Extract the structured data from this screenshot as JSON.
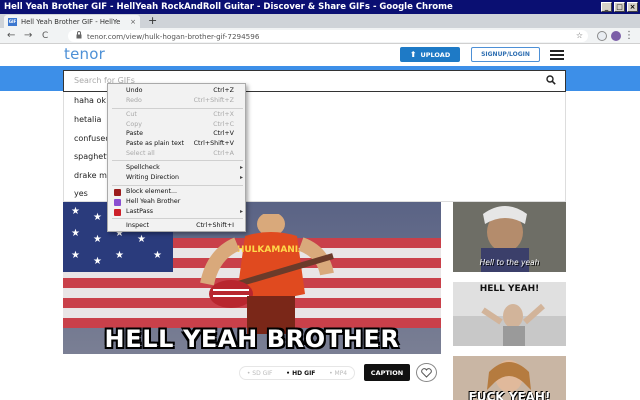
{
  "window": {
    "title": "Hell Yeah Brother GIF - HellYeah RockAndRoll Guitar - Discover & Share GIFs - Google Chrome",
    "controls": [
      "_",
      "□",
      "×"
    ]
  },
  "browser": {
    "tab_title": "Hell Yeah Brother GIF - HellYe",
    "tab_close": "×",
    "new_tab": "+",
    "url": "tenor.com/view/hulk-hogan-brother-gif-7294596",
    "back": "←",
    "forward": "→",
    "reload": "C",
    "home": "⌂",
    "lock": "🔒",
    "star": "☆",
    "menu": "⋮",
    "favicon_text": "GIF"
  },
  "site": {
    "logo": "tenor",
    "upload_label": "UPLOAD",
    "upload_arrow": "⬆",
    "signup_label": "SIGNUP/LOGIN",
    "search_placeholder": "Search for GIFs",
    "suggestions": [
      "haha ok",
      "hetalia",
      "confused",
      "spaghetti",
      "drake meme",
      "yes"
    ]
  },
  "gif": {
    "caption": "HELL YEAH BROTHER",
    "formats": [
      "SD GIF",
      "HD GIF",
      "MP4"
    ],
    "active_format": "HD GIF",
    "caption_button": "CAPTION"
  },
  "related": {
    "first_caption": "Hell to the yeah",
    "second_caption": "HELL YEAH!",
    "third_caption": "FUCK YEAH!"
  },
  "context_menu": {
    "items": [
      {
        "label": "Undo",
        "shortcut": "Ctrl+Z",
        "disabled": false
      },
      {
        "label": "Redo",
        "shortcut": "Ctrl+Shift+Z",
        "disabled": true
      },
      {
        "label": "Cut",
        "shortcut": "Ctrl+X",
        "disabled": true
      },
      {
        "label": "Copy",
        "shortcut": "Ctrl+C",
        "disabled": true
      },
      {
        "label": "Paste",
        "shortcut": "Ctrl+V",
        "disabled": false
      },
      {
        "label": "Paste as plain text",
        "shortcut": "Ctrl+Shift+V",
        "disabled": false
      },
      {
        "label": "Select all",
        "shortcut": "Ctrl+A",
        "disabled": true
      },
      {
        "label": "Spellcheck",
        "shortcut": "",
        "submenu": true
      },
      {
        "label": "Writing Direction",
        "shortcut": "",
        "submenu": true
      },
      {
        "label": "Block element...",
        "shortcut": "",
        "icon": "ublock-icon"
      },
      {
        "label": "Hell Yeah Brother",
        "shortcut": "",
        "icon": "extension-icon"
      },
      {
        "label": "LastPass",
        "shortcut": "",
        "submenu": true,
        "icon": "lastpass-icon"
      },
      {
        "label": "Inspect",
        "shortcut": "Ctrl+Shift+I",
        "disabled": false
      }
    ]
  },
  "colors": {
    "title_bar": "#0a0f72",
    "tenor_blue": "#3d8fe8",
    "upload_blue": "#1e7ac6"
  }
}
